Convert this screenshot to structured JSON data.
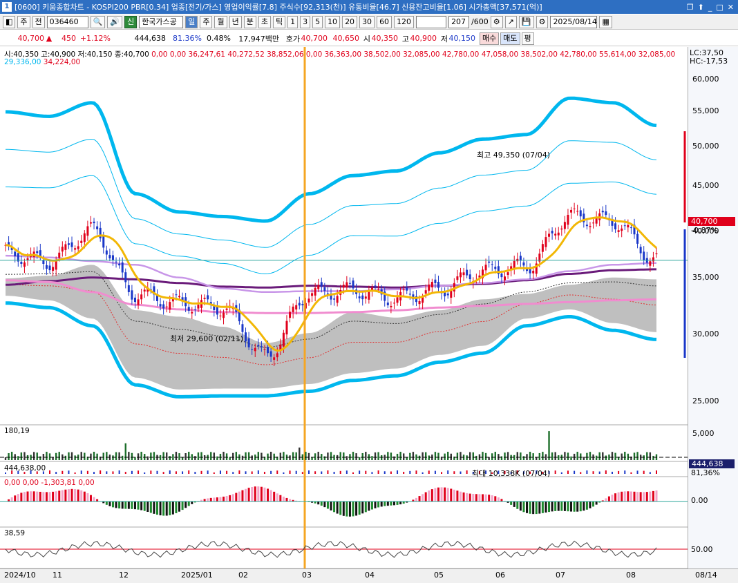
{
  "titlebar": {
    "num": "1",
    "text": "[0600] 키움종합차트 - KOSPI200 PBR[0.34] 업종[전기/가스] 영업이익률[7.8] 주식수[92,313(천)] 유통비율[46.7] 신용잔고비율[1.06] 시가총액[37,571(억)]"
  },
  "toolbar": {
    "period": "주",
    "prev": "전",
    "code": "036460",
    "name_badge": "신",
    "name": "한국가스공",
    "tf": [
      "일",
      "주",
      "월",
      "년",
      "분",
      "초",
      "틱"
    ],
    "mins": [
      "1",
      "3",
      "5",
      "10",
      "20",
      "30",
      "60",
      "120"
    ],
    "count": "207",
    "count_max": "/600",
    "date": "2025/08/14"
  },
  "quote": {
    "price": "40,700",
    "arrow": "▲",
    "change": "450",
    "pct": "+1.12%",
    "volume": "444,638",
    "vol_ratio": "81.36%",
    "turnover": "0.48%",
    "amount": "17,947백만",
    "ask_label": "호가",
    "ask": "40,700",
    "bid": "40,650",
    "open_label": "시",
    "open": "40,350",
    "high_label": "고",
    "high": "40,900",
    "low_label": "저",
    "low": "40,150",
    "buy": "매수",
    "sell": "매도",
    "flat": "평"
  },
  "legend1": {
    "ohlc": "시:40,350 고:40,900 저:40,150 종:40,700",
    "vals": "0,00  0,00  36,247,61  40,272,52  38,852,06  0,00  36,363,00  38,502,00  32,085,00  42,780,00  47,058,00  38,502,00  42,780,00  55,614,00  32,085,00",
    "row2a": "29,336,00",
    "row2b": "34,224,00",
    "lc": "LC:37,50",
    "hc": "HC:-17,53"
  },
  "annotations": {
    "high": "최고 49,350 (07/04)",
    "low": "최저 29,600 (02/11)",
    "maxvol": "최대 10,338K (07/04)"
  },
  "price_axis": [
    "60,000",
    "55,000",
    "50,000",
    "45,000",
    "40,000",
    "35,000",
    "30,000",
    "25,000"
  ],
  "current_price": {
    "label": "40,700",
    "pct": "-0,87%"
  },
  "volume": {
    "legend": "180,19",
    "axis": "5,000",
    "current": "444,638",
    "pct": "81,36%"
  },
  "volume2": {
    "legend": "444,638,00"
  },
  "macd": {
    "legend": "0,00  0,00  -1,303,81  0,00",
    "axis": "0.00"
  },
  "rsi": {
    "legend": "38,59",
    "axis": "50.00"
  },
  "xaxis": [
    "2024/10",
    "11",
    "12",
    "2025/01",
    "02",
    "03",
    "04",
    "05",
    "06",
    "07",
    "08"
  ],
  "xaxis_right": "08/14",
  "colors": {
    "up": "#e0001b",
    "down": "#1a37c8",
    "bb": "#00b7ee",
    "ma": "#f2b705",
    "ma2": "#6a1b7a",
    "pink": "#f08ccf",
    "orange_line": "#f5a623"
  },
  "chart_data": {
    "type": "candlestick",
    "ylim": [
      23000,
      62000
    ],
    "last_close": 40700,
    "high": {
      "value": 49350,
      "date": "07/04"
    },
    "low": {
      "value": 29600,
      "date": "02/11"
    }
  }
}
